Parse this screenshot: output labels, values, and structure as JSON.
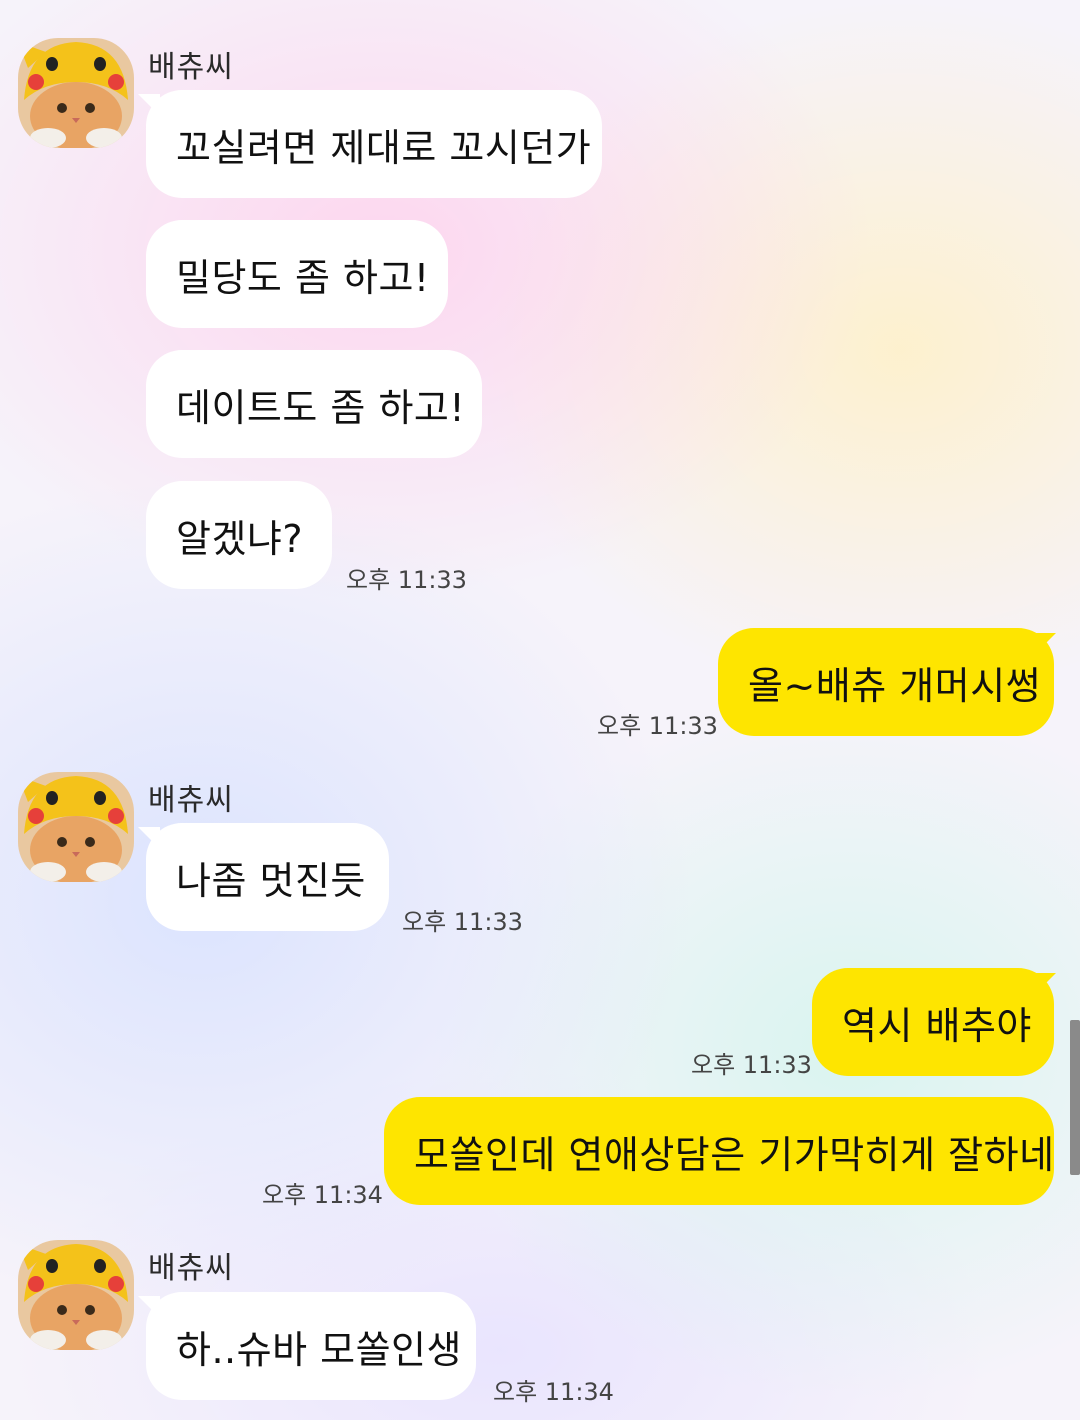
{
  "chat": {
    "sender_name": "배츄씨",
    "messages": [
      {
        "from": "them",
        "text": "꼬실려면 제대로 꼬시던가"
      },
      {
        "from": "them",
        "text": "밀당도 좀 하고!"
      },
      {
        "from": "them",
        "text": "데이트도 좀 하고!"
      },
      {
        "from": "them",
        "text": "알겠냐?",
        "time": "오후 11:33"
      },
      {
        "from": "me",
        "text": "올~배츄 개머시썽",
        "time": "오후 11:33"
      },
      {
        "from": "them",
        "text": "나좀 멋진듯",
        "time": "오후 11:33"
      },
      {
        "from": "me",
        "text": "역시 배추야",
        "time": "오후 11:33"
      },
      {
        "from": "me",
        "text": "모쏠인데 연애상담은 기가막히게 잘하네",
        "time": "오후 11:34"
      },
      {
        "from": "them",
        "text": "하..슈바 모쏠인생",
        "time": "오후 11:34"
      }
    ]
  },
  "colors": {
    "incoming_bubble": "#ffffff",
    "outgoing_bubble": "#fee500",
    "timestamp": "#444444"
  },
  "icons": {
    "avatar": "cat-in-pikachu-hood-avatar"
  }
}
